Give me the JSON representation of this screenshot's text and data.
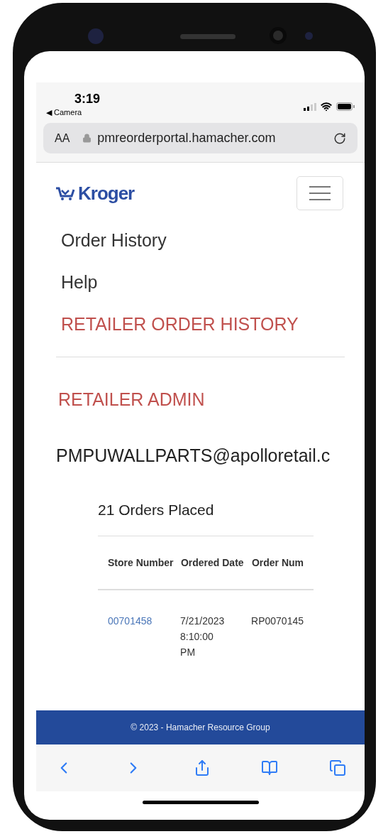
{
  "status_bar": {
    "time": "3:19",
    "back_app": "◀ Camera"
  },
  "address_bar": {
    "text_size": "AA",
    "url": "pmreorderportal.hamacher.com"
  },
  "brand": {
    "logo": "Kroger"
  },
  "nav_links": [
    {
      "label": "Order History",
      "kind": "link"
    },
    {
      "label": "Help",
      "kind": "link"
    },
    {
      "label": "RETAILER ORDER HISTORY",
      "kind": "retailer"
    }
  ],
  "admin_link": "RETAILER ADMIN",
  "user_email": "PMPUWALLPARTS@apolloretail.c",
  "orders": {
    "count_label": "21 Orders Placed",
    "columns": [
      "Store Number",
      "Ordered Date",
      "Order Num"
    ],
    "rows": [
      {
        "store_number": "00701458",
        "ordered_date": "7/21/2023 8:10:00 PM",
        "order_number": "RP0070145"
      }
    ]
  },
  "footer": "© 2023 - Hamacher Resource Group"
}
